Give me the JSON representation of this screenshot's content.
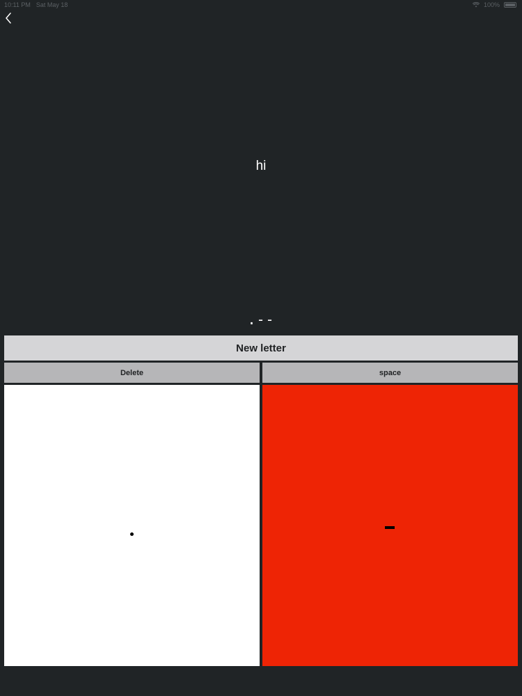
{
  "status_bar": {
    "time": "10:11 PM",
    "date": "Sat May 18",
    "battery": "100%",
    "icons": [
      "wifi-icon",
      "battery-icon"
    ]
  },
  "navigation": {
    "back_icon": "chevron-left-icon"
  },
  "translation": {
    "text": "hi"
  },
  "input": {
    "current_code": ".--"
  },
  "controls": {
    "new_letter_label": "New letter",
    "delete_label": "Delete",
    "space_label": "space"
  },
  "pads": {
    "dot_symbol": "dot",
    "dash_symbol": "dash",
    "dot_color": "#ffffff",
    "dash_color": "#ee2405"
  }
}
